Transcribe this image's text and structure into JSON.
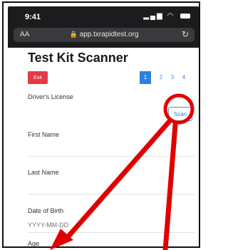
{
  "status_bar": {
    "time": "9:41",
    "signal_icons": "signal-wifi-battery"
  },
  "browser": {
    "text_size_label": "AA",
    "url": "app.txrapidtest.org"
  },
  "page": {
    "title": "Test Kit Scanner",
    "exit_label": "Exit",
    "pages": [
      "1",
      "2",
      "3",
      "4"
    ],
    "active_page": "1"
  },
  "form": {
    "drivers_license_label": "Driver's License",
    "scan_label": "Scan",
    "first_name_label": "First Name",
    "last_name_label": "Last Name",
    "dob_label": "Date of Birth",
    "dob_placeholder": "YYYY-MM-DD",
    "age_label": "Age"
  },
  "annotation": {
    "highlight_color": "#e00000",
    "target": "Scan"
  }
}
